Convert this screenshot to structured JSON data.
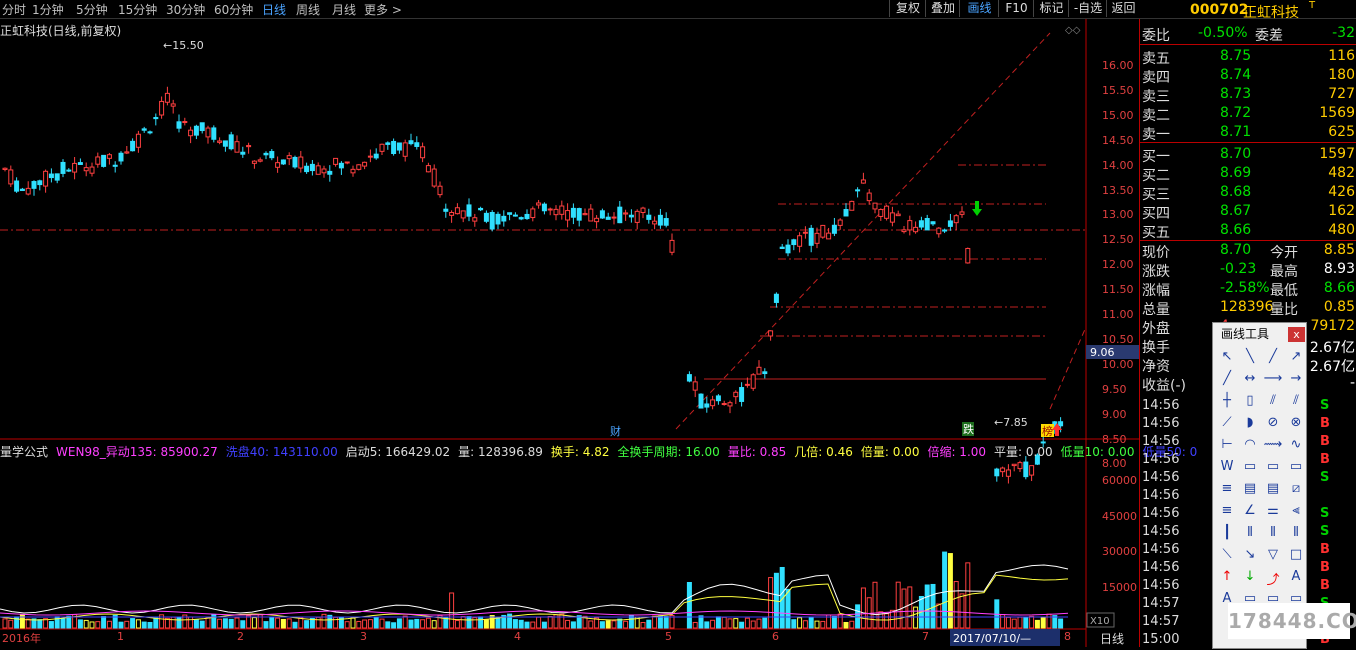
{
  "periods": [
    {
      "label": "分时",
      "active": false
    },
    {
      "label": "1分钟",
      "active": false
    },
    {
      "label": "5分钟",
      "active": false
    },
    {
      "label": "15分钟",
      "active": false
    },
    {
      "label": "30分钟",
      "active": false
    },
    {
      "label": "60分钟",
      "active": false
    },
    {
      "label": "日线",
      "active": true
    },
    {
      "label": "周线",
      "active": false
    },
    {
      "label": "月线",
      "active": false
    },
    {
      "label": "更多 >",
      "active": false
    }
  ],
  "toolbar": [
    {
      "label": "复权",
      "active": false
    },
    {
      "label": "叠加",
      "active": false
    },
    {
      "label": "画线",
      "active": true
    },
    {
      "label": "F10",
      "active": false
    },
    {
      "label": "标记",
      "active": false
    },
    {
      "label": "-自选",
      "active": false
    },
    {
      "label": "返回",
      "active": false
    }
  ],
  "stock": {
    "code": "000702",
    "name": "正虹科技",
    "superscript": "T"
  },
  "chart": {
    "title": "正虹科技(日线,前复权)",
    "price_axis": [
      "16.00",
      "15.50",
      "15.00",
      "14.50",
      "14.00",
      "13.50",
      "13.00",
      "12.50",
      "12.00",
      "11.50",
      "11.00",
      "10.50",
      "10.00",
      "9.50",
      "9.00",
      "8.50",
      "8.00"
    ],
    "vol_axis": [
      "60000",
      "45000",
      "30000",
      "15000"
    ],
    "vol_multiplier": "X10",
    "high_label": "15.50",
    "low_label": "7.85",
    "current_marker": "9.06",
    "markers": {
      "cai": "财",
      "die": "跌",
      "bang": "榜"
    },
    "bottom_axis": [
      "2016年",
      "1",
      "2",
      "3",
      "4",
      "5",
      "6",
      "7",
      "8"
    ],
    "date_box": "2017/07/10/—",
    "period_label": "日线"
  },
  "indicators": [
    {
      "label": "量学公式",
      "color": "#dddddd"
    },
    {
      "label": "WEN98_异动135: 85900.27",
      "color": "#ff40ff"
    },
    {
      "label": "洗盘40: 143110.00",
      "color": "#4040ff"
    },
    {
      "label": "启动5: 166429.02",
      "color": "#dddddd"
    },
    {
      "label": "量: 128396.89",
      "color": "#dddddd"
    },
    {
      "label": "换手: 4.82",
      "color": "#ffff40"
    },
    {
      "label": "全换手周期: 16.00",
      "color": "#40ff40"
    },
    {
      "label": "量比: 0.85",
      "color": "#ff40ff"
    },
    {
      "label": "几倍: 0.46",
      "color": "#ffff40"
    },
    {
      "label": "倍量: 0.00",
      "color": "#ffff40"
    },
    {
      "label": "倍缩: 1.00",
      "color": "#ff40ff"
    },
    {
      "label": "平量: 0.00",
      "color": "#dddddd"
    },
    {
      "label": "低量10: 0.00",
      "color": "#40ff40"
    },
    {
      "label": "低量50: 0",
      "color": "#4040ff"
    }
  ],
  "quote": {
    "weibi_label": "委比",
    "weibi": "-0.50%",
    "weicha_label": "委差",
    "weicha": "-32",
    "sells": [
      {
        "label": "卖五",
        "price": "8.75",
        "vol": "116"
      },
      {
        "label": "卖四",
        "price": "8.74",
        "vol": "180"
      },
      {
        "label": "卖三",
        "price": "8.73",
        "vol": "727"
      },
      {
        "label": "卖二",
        "price": "8.72",
        "vol": "1569"
      },
      {
        "label": "卖一",
        "price": "8.71",
        "vol": "625"
      }
    ],
    "buys": [
      {
        "label": "买一",
        "price": "8.70",
        "vol": "1597"
      },
      {
        "label": "买二",
        "price": "8.69",
        "vol": "482"
      },
      {
        "label": "买三",
        "price": "8.68",
        "vol": "426"
      },
      {
        "label": "买四",
        "price": "8.67",
        "vol": "162"
      },
      {
        "label": "买五",
        "price": "8.66",
        "vol": "480"
      }
    ],
    "stats": [
      {
        "l1": "现价",
        "v1": "8.70",
        "c1": "#00e000",
        "l2": "今开",
        "v2": "8.85",
        "c2": "#ffcc00"
      },
      {
        "l1": "涨跌",
        "v1": "-0.23",
        "c1": "#00e000",
        "l2": "最高",
        "v2": "8.93",
        "c2": "#ffffff"
      },
      {
        "l1": "涨幅",
        "v1": "-2.58%",
        "c1": "#00e000",
        "l2": "最低",
        "v2": "8.66",
        "c2": "#00e000"
      },
      {
        "l1": "总量",
        "v1": "128396",
        "c1": "#ffcc00",
        "l2": "量比",
        "v2": "0.85",
        "c2": "#ffcc00"
      },
      {
        "l1": "外盘",
        "v1": "4",
        "c1": "#ff4040",
        "l2": "",
        "v2": "79172",
        "c2": "#ffcc00"
      },
      {
        "l1": "换手",
        "v1": "",
        "c1": "#ffcc00",
        "l2": "",
        "v2": "2.67亿",
        "c2": "#ffffff"
      },
      {
        "l1": "净资",
        "v1": "",
        "c1": "#ffcc00",
        "l2": "",
        "v2": "2.67亿",
        "c2": "#ffffff"
      },
      {
        "l1": "收益(-)",
        "v1": "",
        "c1": "#ffcc00",
        "l2": "",
        "v2": "-",
        "c2": "#ffffff"
      }
    ],
    "ticks": [
      {
        "time": "14:56",
        "side": "S"
      },
      {
        "time": "14:56",
        "side": "B"
      },
      {
        "time": "14:56",
        "side": "B"
      },
      {
        "time": "14:56",
        "side": "B"
      },
      {
        "time": "14:56",
        "side": "S"
      },
      {
        "time": "14:56",
        "side": ""
      },
      {
        "time": "14:56",
        "side": "S"
      },
      {
        "time": "14:56",
        "side": "S"
      },
      {
        "time": "14:56",
        "side": "B"
      },
      {
        "time": "14:56",
        "side": "B"
      },
      {
        "time": "14:56",
        "side": "B"
      },
      {
        "time": "14:57",
        "side": "S"
      },
      {
        "time": "14:57",
        "side": "B"
      },
      {
        "time": "15:00",
        "side": "B"
      }
    ]
  },
  "palette": {
    "title": "画线工具",
    "close": "x"
  },
  "watermark": "178448.COM"
}
